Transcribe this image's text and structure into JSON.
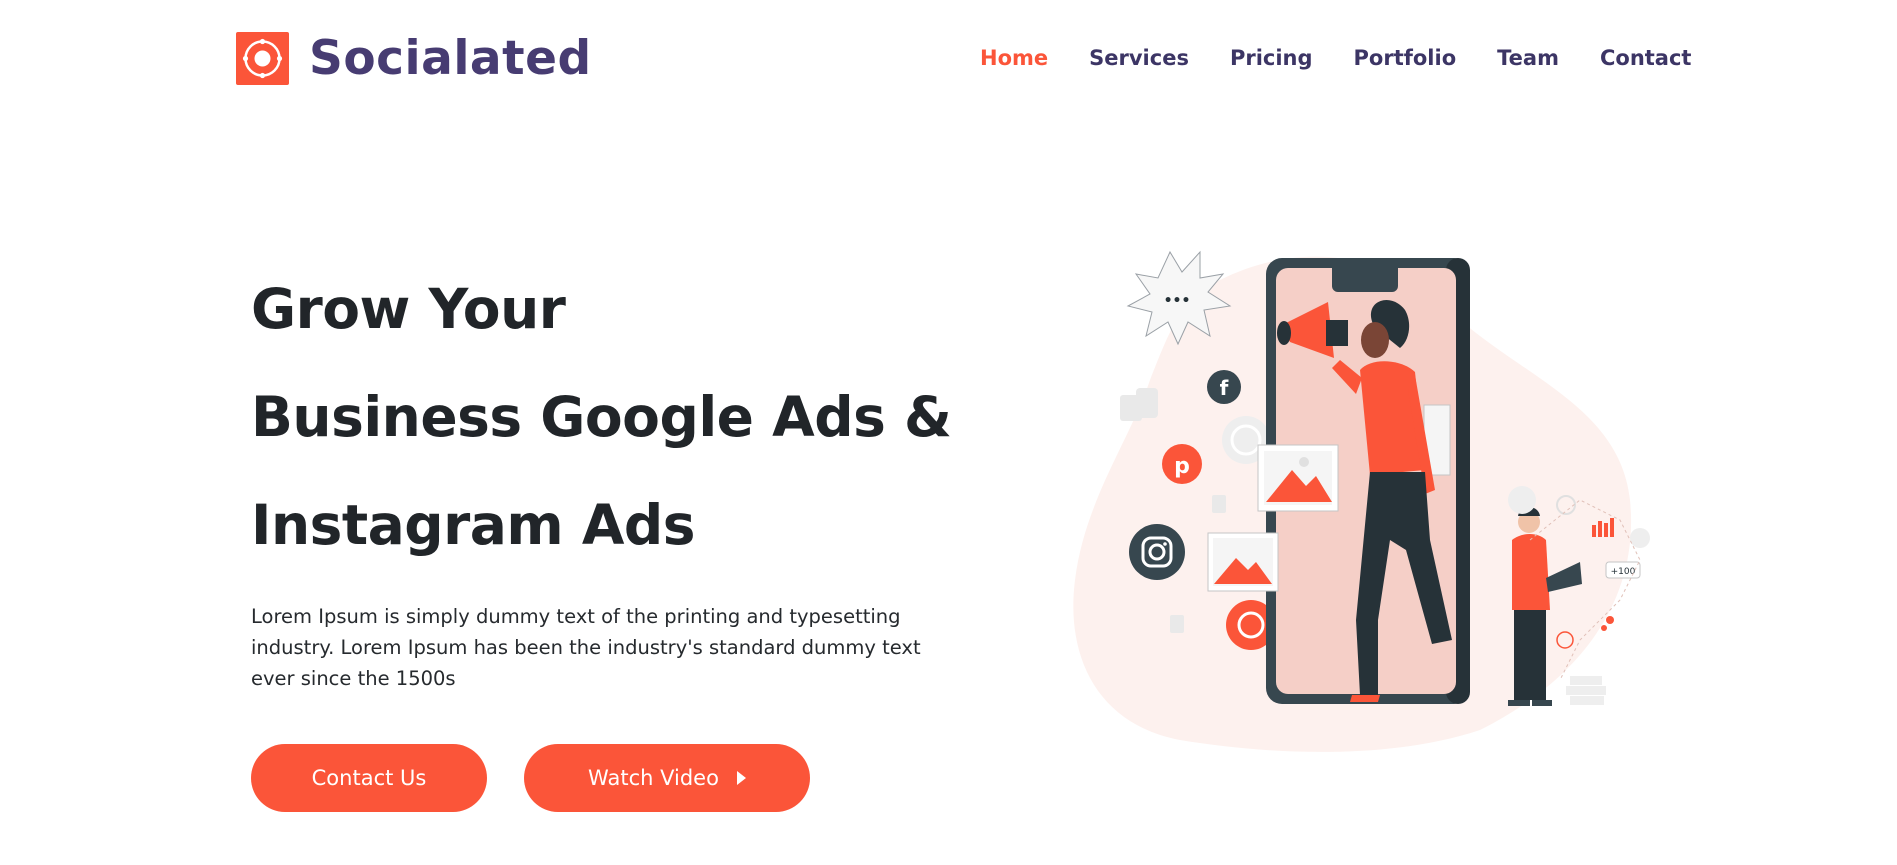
{
  "brand": {
    "name": "Socialated",
    "logo_icon": "target-circle-icon",
    "accent_color": "#fb5539",
    "brand_color": "#473c72"
  },
  "nav": {
    "items": [
      {
        "label": "Home",
        "active": true
      },
      {
        "label": "Services",
        "active": false
      },
      {
        "label": "Pricing",
        "active": false
      },
      {
        "label": "Portfolio",
        "active": false
      },
      {
        "label": "Team",
        "active": false
      },
      {
        "label": "Contact",
        "active": false
      }
    ]
  },
  "hero": {
    "title_lines": [
      "Grow Your",
      "Business Google Ads &",
      "Instagram Ads"
    ],
    "description": "Lorem Ipsum is simply dummy text of the printing and typesetting industry. Lorem Ipsum has been the industry's standard dummy text ever since the 1500s",
    "contact_label": "Contact Us",
    "video_label": "Watch Video",
    "video_icon": "play-icon"
  },
  "illustration": {
    "speech_bubble_text": "•••",
    "social_icons": [
      "facebook-icon",
      "pinterest-icon",
      "instagram-icon",
      "whatsapp-icon",
      "dribbble-icon"
    ],
    "badge_text": "+100"
  }
}
